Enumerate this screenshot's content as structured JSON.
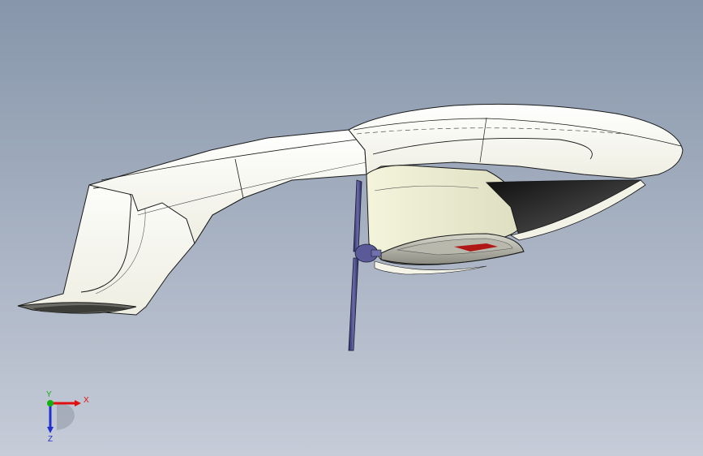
{
  "viewport": {
    "background_top": "#8796ab",
    "background_bottom": "#c6ccd8"
  },
  "model": {
    "body_color": "#fbfbf4",
    "edge_color": "#1a1a1a",
    "propeller_color": "#4a4a86",
    "accent_color": "#b01818"
  },
  "triad": {
    "x_label": "X",
    "y_label": "Y",
    "z_label": "Z",
    "x_color": "#e01010",
    "y_color": "#10b010",
    "z_color": "#2030d0"
  }
}
